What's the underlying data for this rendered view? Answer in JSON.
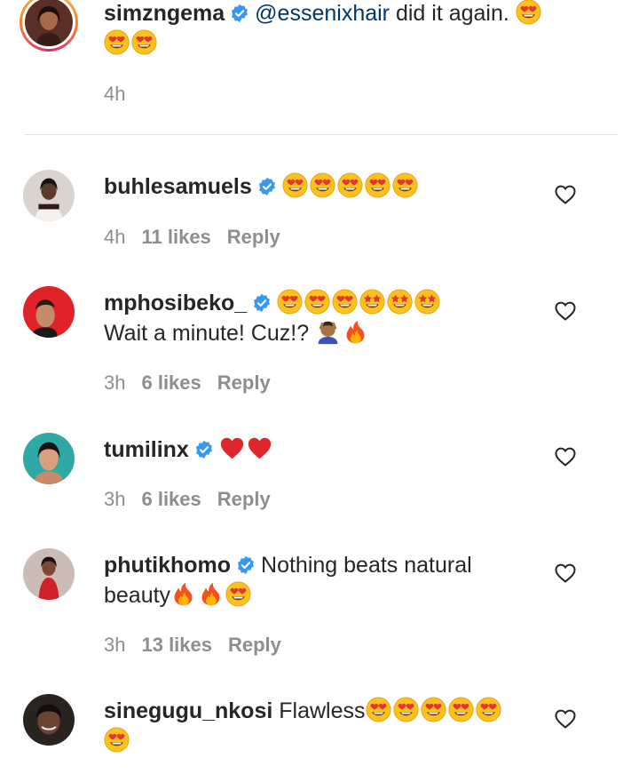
{
  "caption": {
    "username": "simzngema",
    "mention": "@essenixhair",
    "text": "did it again.",
    "time": "4h"
  },
  "comments": [
    {
      "username": "buhlesamuels",
      "text": "",
      "time": "4h",
      "likes": "11 likes",
      "reply": "Reply"
    },
    {
      "username": "mphosibeko_",
      "text": "Wait a minute! Cuz!?",
      "time": "3h",
      "likes": "6 likes",
      "reply": "Reply"
    },
    {
      "username": "tumilinx",
      "text": "",
      "time": "3h",
      "likes": "6 likes",
      "reply": "Reply"
    },
    {
      "username": "phutikhomo",
      "text": "Nothing beats natural",
      "text2": "beauty",
      "time": "3h",
      "likes": "13 likes",
      "reply": "Reply"
    },
    {
      "username": "sinegugu_nkosi",
      "text": "Flawless",
      "time": "",
      "likes": "",
      "reply": ""
    }
  ],
  "colors": {
    "verified": "#3897f0",
    "text": "#262626",
    "meta": "#8e8e8e",
    "mention": "#00376b"
  }
}
